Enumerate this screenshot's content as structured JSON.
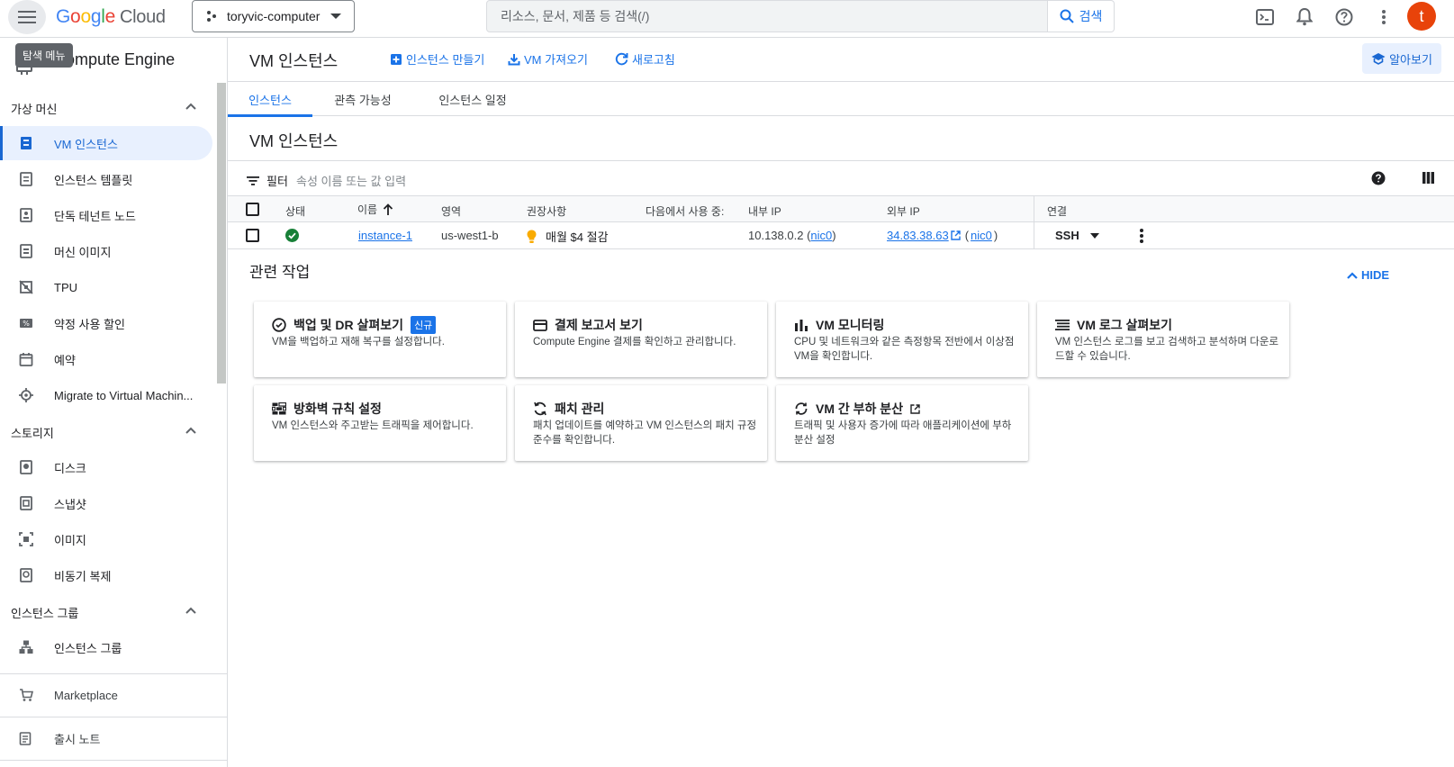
{
  "topbar": {
    "menu_tooltip": "탐색 메뉴",
    "logo_google": [
      "G",
      "o",
      "o",
      "g",
      "l",
      "e"
    ],
    "logo_cloud": "Cloud",
    "project": "toryvic-computer",
    "search_placeholder": "리소스, 문서, 제품 등 검색(/)",
    "search_button": "검색",
    "avatar_letter": "t"
  },
  "sidebar": {
    "title": "Compute Engine",
    "sections": [
      {
        "label": "가상 머신"
      },
      {
        "label": "스토리지"
      },
      {
        "label": "인스턴스 그룹"
      }
    ],
    "items": [
      {
        "label": "VM 인스턴스",
        "icon": "vm-instance-icon"
      },
      {
        "label": "인스턴스 템플릿",
        "icon": "instance-template-icon"
      },
      {
        "label": "단독 테넌트 노드",
        "icon": "sole-tenant-icon"
      },
      {
        "label": "머신 이미지",
        "icon": "machine-image-icon"
      },
      {
        "label": "TPU",
        "icon": "tpu-icon"
      },
      {
        "label": "약정 사용 할인",
        "icon": "discount-icon"
      },
      {
        "label": "예약",
        "icon": "calendar-icon"
      },
      {
        "label": "Migrate to Virtual Machin...",
        "icon": "migrate-icon"
      },
      {
        "label": "디스크",
        "icon": "disk-icon"
      },
      {
        "label": "스냅샷",
        "icon": "snapshot-icon"
      },
      {
        "label": "이미지",
        "icon": "image-icon"
      },
      {
        "label": "비동기 복제",
        "icon": "async-replication-icon"
      },
      {
        "label": "인스턴스 그룹",
        "icon": "instance-group-icon"
      }
    ],
    "marketplace": "Marketplace",
    "release_notes": "출시 노트"
  },
  "main": {
    "page_title": "VM 인스턴스",
    "actions": {
      "create": "인스턴스 만들기",
      "import": "VM 가져오기",
      "refresh": "새로고침",
      "learn": "알아보기"
    },
    "tabs": [
      "인스턴스",
      "관측 가능성",
      "인스턴스 일정"
    ],
    "section_title": "VM 인스턴스",
    "filter_label": "필터",
    "filter_placeholder": "속성 이름 또는 값 입력",
    "columns": [
      "상태",
      "이름",
      "영역",
      "권장사항",
      "다음에서 사용 중:",
      "내부 IP",
      "외부 IP",
      "연결"
    ],
    "row": {
      "name": "instance-1",
      "zone": "us-west1-b",
      "recommendation": "매월 $4 절감",
      "internal_ip": "10.138.0.2",
      "nic": "nic0",
      "external_ip": "34.83.38.63",
      "connect": "SSH",
      "open_paren": "(",
      "close_paren": ")"
    },
    "related": {
      "title": "관련 작업",
      "hide": "HIDE",
      "new_badge": "신규",
      "cards": [
        {
          "title": "백업 및 DR 살펴보기",
          "desc": "VM을 백업하고 재해 복구를 설정합니다."
        },
        {
          "title": "결제 보고서 보기",
          "desc": "Compute Engine 결제를 확인하고 관리합니다."
        },
        {
          "title": "VM 모니터링",
          "desc": "CPU 및 네트워크와 같은 측정항목 전반에서 이상점 VM을 확인합니다."
        },
        {
          "title": "VM 로그 살펴보기",
          "desc": "VM 인스턴스 로그를 보고 검색하고 분석하며 다운로드할 수 있습니다."
        },
        {
          "title": "방화벽 규칙 설정",
          "desc": "VM 인스턴스와 주고받는 트래픽을 제어합니다."
        },
        {
          "title": "패치 관리",
          "desc": "패치 업데이트를 예약하고 VM 인스턴스의 패치 규정 준수를 확인합니다."
        },
        {
          "title": "VM 간 부하 분산",
          "desc": "트래픽 및 사용자 증가에 따라 애플리케이션에 부하 분산 설정"
        }
      ]
    }
  }
}
